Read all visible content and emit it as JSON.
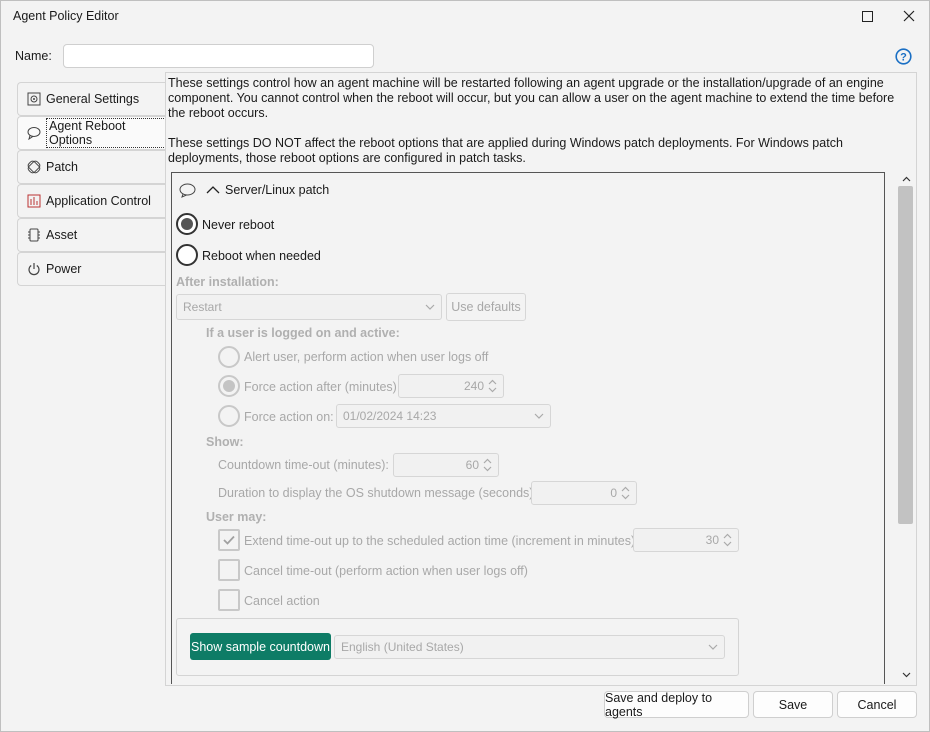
{
  "window": {
    "title": "Agent Policy Editor"
  },
  "name_field": {
    "label": "Name:",
    "value": ""
  },
  "tabs": [
    {
      "label": "General Settings",
      "icon": "general-settings-icon"
    },
    {
      "label": "Agent Reboot Options",
      "icon": "reboot-bubble-icon",
      "active": true
    },
    {
      "label": "Patch",
      "icon": "patch-icon"
    },
    {
      "label": "Application Control",
      "icon": "application-control-icon"
    },
    {
      "label": "Asset",
      "icon": "asset-chip-icon"
    },
    {
      "label": "Power",
      "icon": "power-icon"
    }
  ],
  "description": {
    "para1": "These settings control how an agent machine will be restarted following an agent upgrade or the installation/upgrade of an engine component. You cannot control when the reboot will occur, but you can allow a user on the agent machine to extend the time before the reboot occurs.",
    "para2": "These settings DO NOT affect the reboot options that are applied during Windows patch deployments. For Windows patch deployments, those reboot options are configured in patch tasks."
  },
  "section": {
    "title": "Server/Linux patch",
    "never_reboot": "Never reboot",
    "reboot_when_needed": "Reboot when needed",
    "selected": "never_reboot"
  },
  "after_installation": {
    "label": "After installation:",
    "action_value": "Restart",
    "use_defaults": "Use defaults"
  },
  "logged_on": {
    "label": "If a user is logged on and active:",
    "alert_option": "Alert user, perform action when user logs off",
    "force_after_option": "Force action after (minutes)",
    "force_after_value": "240",
    "force_on_option": "Force action on:",
    "force_on_value": "01/02/2024 14:23",
    "selected": "force_after"
  },
  "show": {
    "label": "Show:",
    "countdown_label": "Countdown time-out (minutes):",
    "countdown_value": "60",
    "duration_label": "Duration to display the OS shutdown message (seconds):",
    "duration_value": "0"
  },
  "user_may": {
    "label": "User may:",
    "extend_label": "Extend time-out up to the scheduled action time (increment in minutes)",
    "extend_checked": true,
    "extend_value": "30",
    "cancel_timeout_label": "Cancel time-out (perform action when user logs off)",
    "cancel_timeout_checked": false,
    "cancel_action_label": "Cancel action",
    "cancel_action_checked": false
  },
  "sample": {
    "button_label": "Show sample countdown",
    "language_value": "English (United States)"
  },
  "footer": {
    "save_deploy": "Save and deploy to agents",
    "save": "Save",
    "cancel": "Cancel"
  },
  "colors": {
    "accent": "#0e7c66",
    "help": "#1a6fc4"
  }
}
